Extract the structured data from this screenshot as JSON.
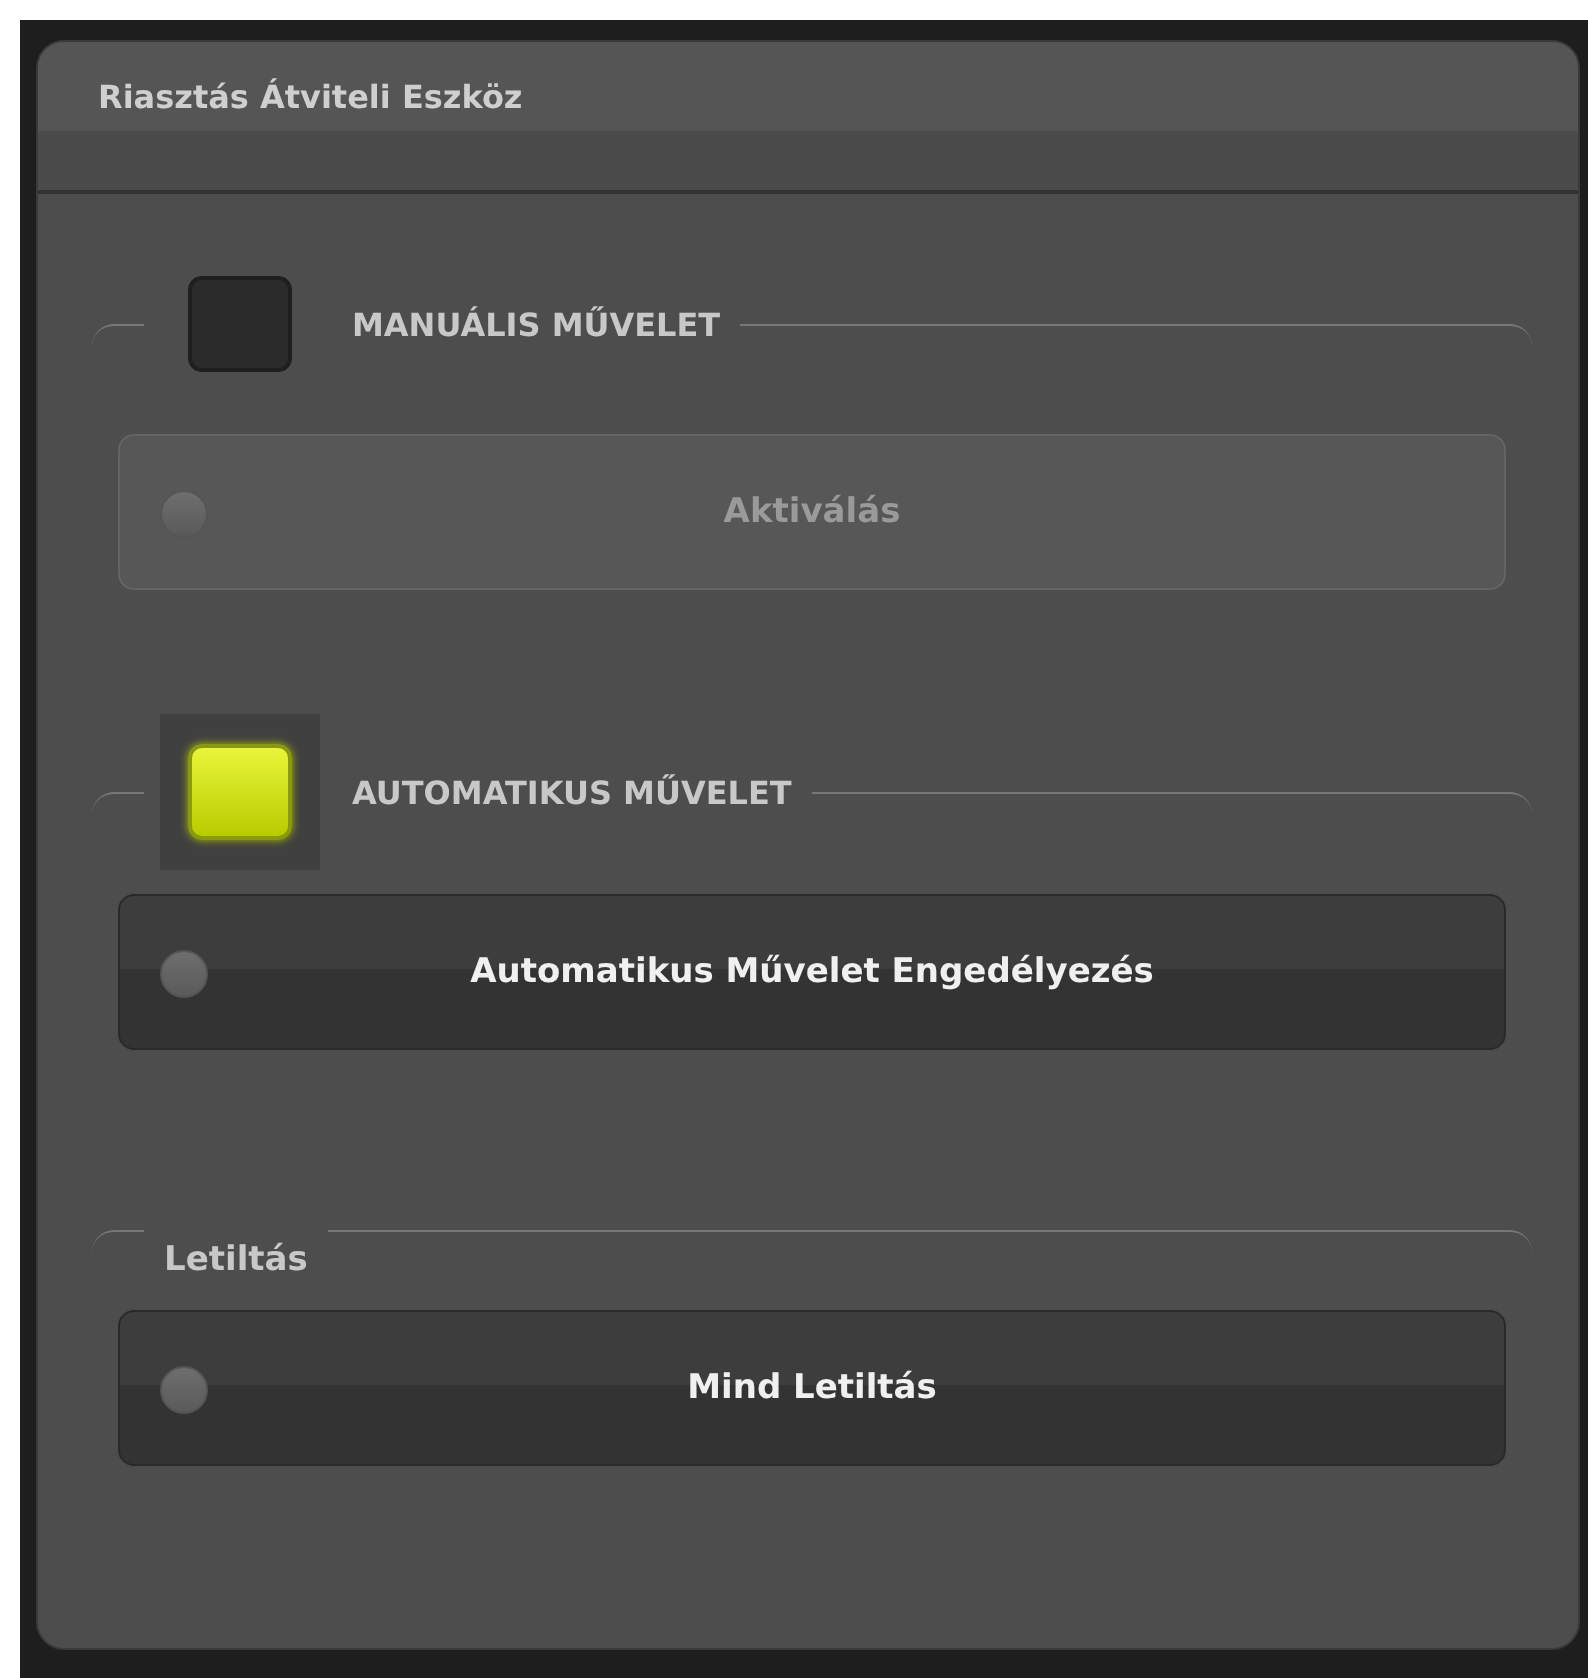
{
  "window": {
    "title": "Riasztás Átviteli Eszköz"
  },
  "sections": [
    {
      "kind": "toggle",
      "label": "MANUÁLIS MŰVELET",
      "on": false,
      "button": {
        "label": "Aktiválás",
        "disabled": true
      }
    },
    {
      "kind": "toggle",
      "label": "AUTOMATIKUS MŰVELET",
      "on": true,
      "button": {
        "label": "Automatikus Művelet Engedélyezés",
        "disabled": false
      }
    },
    {
      "kind": "plain",
      "label": "Letiltás",
      "button": {
        "label": "Mind Letiltás",
        "disabled": false
      }
    }
  ]
}
